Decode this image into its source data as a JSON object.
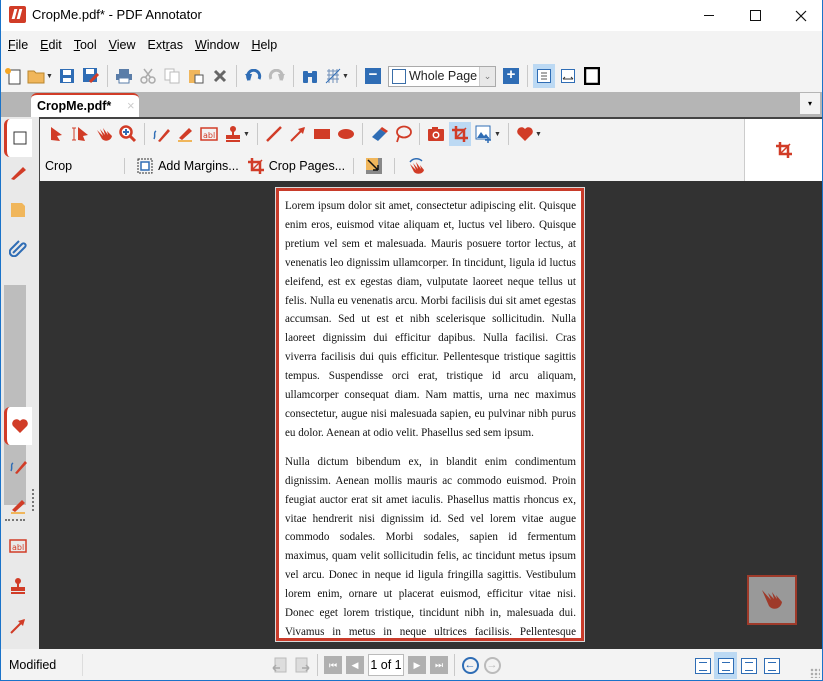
{
  "window": {
    "title": "CropMe.pdf* - PDF Annotator",
    "minimize_icon": "minimize-icon",
    "maximize_icon": "maximize-icon",
    "close_icon": "close-icon"
  },
  "menu": {
    "items": [
      {
        "label": "File",
        "accel": "F"
      },
      {
        "label": "Edit",
        "accel": "E"
      },
      {
        "label": "Tool",
        "accel": "T"
      },
      {
        "label": "View",
        "accel": "V"
      },
      {
        "label": "Extras",
        "accel": "r"
      },
      {
        "label": "Window",
        "accel": "W"
      },
      {
        "label": "Help",
        "accel": "H"
      }
    ]
  },
  "toolbar": {
    "buttons": [
      "new-document-icon",
      "open-folder-icon",
      "save-icon",
      "save-as-icon",
      "print-icon",
      "cut-icon",
      "copy-icon",
      "paste-icon",
      "delete-icon",
      "undo-icon",
      "redo-icon",
      "find-icon",
      "grid-icon"
    ],
    "zoom_value": "Whole Page",
    "zoom_out_label": "−",
    "zoom_in_label": "+",
    "view_modes": [
      "fit-page-icon",
      "fit-width-icon",
      "full-screen-icon"
    ]
  },
  "tabs": {
    "documents": [
      {
        "label": "CropMe.pdf*",
        "close": "×"
      }
    ],
    "dropdown": "▾"
  },
  "side_tabs": {
    "top": [
      "pages-tab",
      "bookmarks-tab",
      "notes-tab",
      "attachments-tab"
    ],
    "bottom": [
      "favorites-tab",
      "pen-tab",
      "highlighter-tab",
      "text-tab",
      "stamp-tab",
      "arrow-tab"
    ]
  },
  "ribbon": {
    "tools": [
      "select-icon",
      "text-select-icon",
      "hand-icon",
      "zoom-icon",
      "pen-icon",
      "highlighter-icon",
      "text-box-icon",
      "stamp-icon",
      "line-icon",
      "arrow-icon",
      "rectangle-icon",
      "ellipse-icon",
      "eraser-icon",
      "lasso-icon",
      "snapshot-icon",
      "crop-icon",
      "insert-image-icon",
      "favorites-icon"
    ],
    "active_tool": "crop-icon",
    "section_label": "Crop",
    "section_accel": "C",
    "add_margins_label": "Add Margins...",
    "crop_pages_label": "Crop Pages...",
    "resize_icon": "resize-page-icon",
    "hand_wave_icon": "touch-icon"
  },
  "document": {
    "paragraphs": [
      "Lorem ipsum dolor sit amet, consectetur adipiscing elit. Quisque enim eros, euismod vitae aliquam et, luctus vel libero. Quisque pretium vel sem et malesuada. Mauris posuere tortor lectus, at venenatis leo dignissim ullamcorper. In tincidunt, ligula id luctus eleifend, est ex egestas diam, vulputate laoreet neque tellus ut felis. Nulla eu venenatis arcu. Morbi facilisis dui sit amet egestas accumsan. Sed ut est et nibh scelerisque sollicitudin. Nulla laoreet dignissim dui efficitur dapibus. Nulla facilisi. Cras viverra facilisis dui quis efficitur. Pellentesque tristique sagittis tempus. Suspendisse orci erat, tristique id arcu aliquam, ullamcorper consequat diam. Nam mattis, urna nec maximus consectetur, augue nisi malesuada sapien, eu pulvinar nibh purus eu dolor. Aenean at odio velit. Phasellus sed sem ipsum.",
      "Nulla dictum bibendum ex, in blandit enim condimentum dignissim. Aenean mollis mauris ac commodo euismod. Proin feugiat auctor erat sit amet iaculis. Phasellus mattis rhoncus ex, vitae hendrerit nisi dignissim id. Sed vel lorem vitae augue commodo sodales. Morbi sodales, sapien id fermentum maximus, quam velit sollicitudin felis, ac tincidunt metus ipsum vel arcu. Donec in neque id ligula fringilla sagittis. Vestibulum lorem enim, ornare ut placerat euismod, efficitur vitae nisi. Donec eget lorem tristique, tincidunt nibh in, malesuada dui. Vivamus in metus in neque ultrices facilisis. Pellentesque ultricies eleifend"
    ]
  },
  "statusbar": {
    "status": "Modified",
    "page_indicator": "1 of 1",
    "layouts": [
      "single-page-icon",
      "continuous-icon",
      "two-page-continuous-icon",
      "book-icon"
    ],
    "active_layout": "continuous-icon"
  },
  "colors": {
    "accent_red": "#d13c27",
    "accent_blue": "#2f6db5",
    "doc_background": "#323232",
    "active_highlight": "#bcd9f3"
  }
}
